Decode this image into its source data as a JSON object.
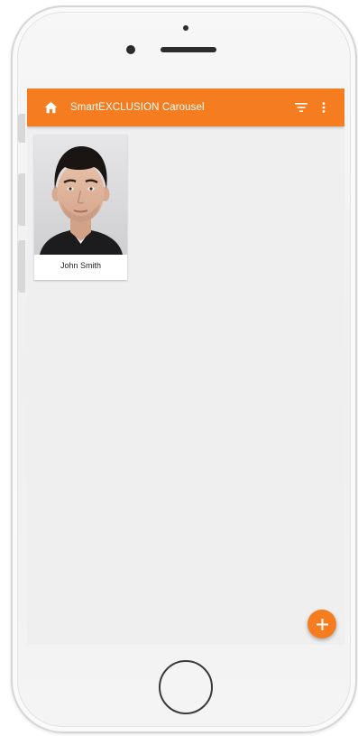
{
  "appbar": {
    "title": "SmartEXCLUSION Carousel",
    "home_icon": "home-icon",
    "filter_icon": "filter-icon",
    "more_icon": "more-vert-icon",
    "color": "#f57c1f"
  },
  "cards": [
    {
      "name": "John Smith",
      "photo": "person-portrait-photo"
    }
  ],
  "fab": {
    "icon": "add-icon",
    "color": "#f57c1f"
  }
}
